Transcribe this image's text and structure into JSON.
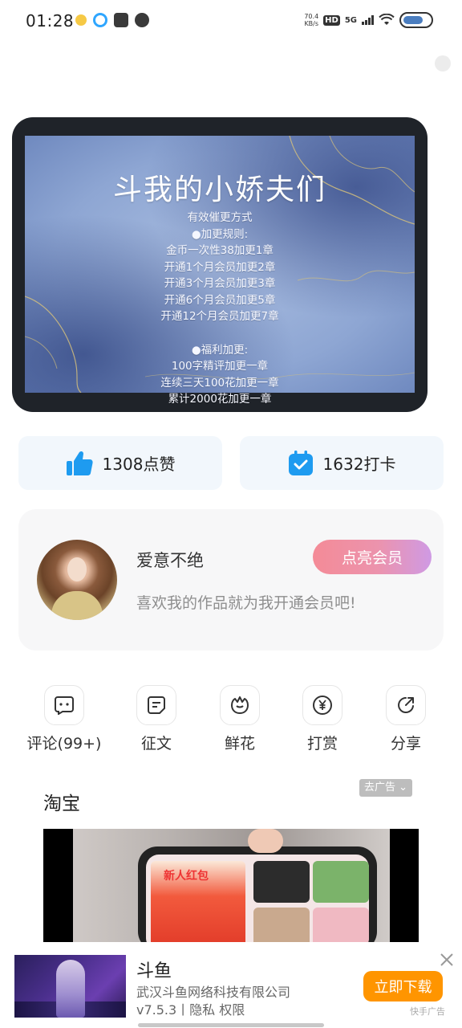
{
  "status_bar": {
    "time": "01:28",
    "net_speed_top": "70.4",
    "net_speed_unit": "KB/s",
    "hd": "HD",
    "network": "5G",
    "battery_color": "#4a7dbf"
  },
  "banner": {
    "title": "斗我的小娇夫们",
    "lines": [
      "有效催更方式",
      "●加更规则:",
      "金币一次性38加更1章",
      "开通1个月会员加更2章",
      "开通3个月会员加更3章",
      "开通6个月会员加更5章",
      "开通12个月会员加更7章"
    ],
    "lines2": [
      "●福利加更:",
      "100字精评加更一章",
      "连续三天100花加更一章",
      "累计2000花加更一章"
    ]
  },
  "stats": {
    "likes": "1308点赞",
    "checkins": "1632打卡",
    "like_icon": "thumbs-up-icon",
    "checkin_icon": "calendar-check-icon",
    "accent": "#1e9bf0"
  },
  "member": {
    "name": "爱意不绝",
    "subtitle": "喜欢我的作品就为我开通会员吧!",
    "button": "点亮会员"
  },
  "actions": [
    {
      "label": "评论(99+)",
      "icon": "comment-icon"
    },
    {
      "label": "征文",
      "icon": "document-icon"
    },
    {
      "label": "鲜花",
      "icon": "flower-icon"
    },
    {
      "label": "打赏",
      "icon": "yuan-coin-icon"
    },
    {
      "label": "分享",
      "icon": "share-icon"
    }
  ],
  "ad": {
    "title": "淘宝",
    "close_tag": "去广告",
    "video_badge": "新人红包"
  },
  "bottom_ad": {
    "app_name": "斗鱼",
    "company": "武汉斗鱼网络科技有限公司",
    "meta": "v7.5.3丨隐私  权限",
    "download": "立即下载",
    "source": "快手广告",
    "button_color": "#ff9500"
  }
}
